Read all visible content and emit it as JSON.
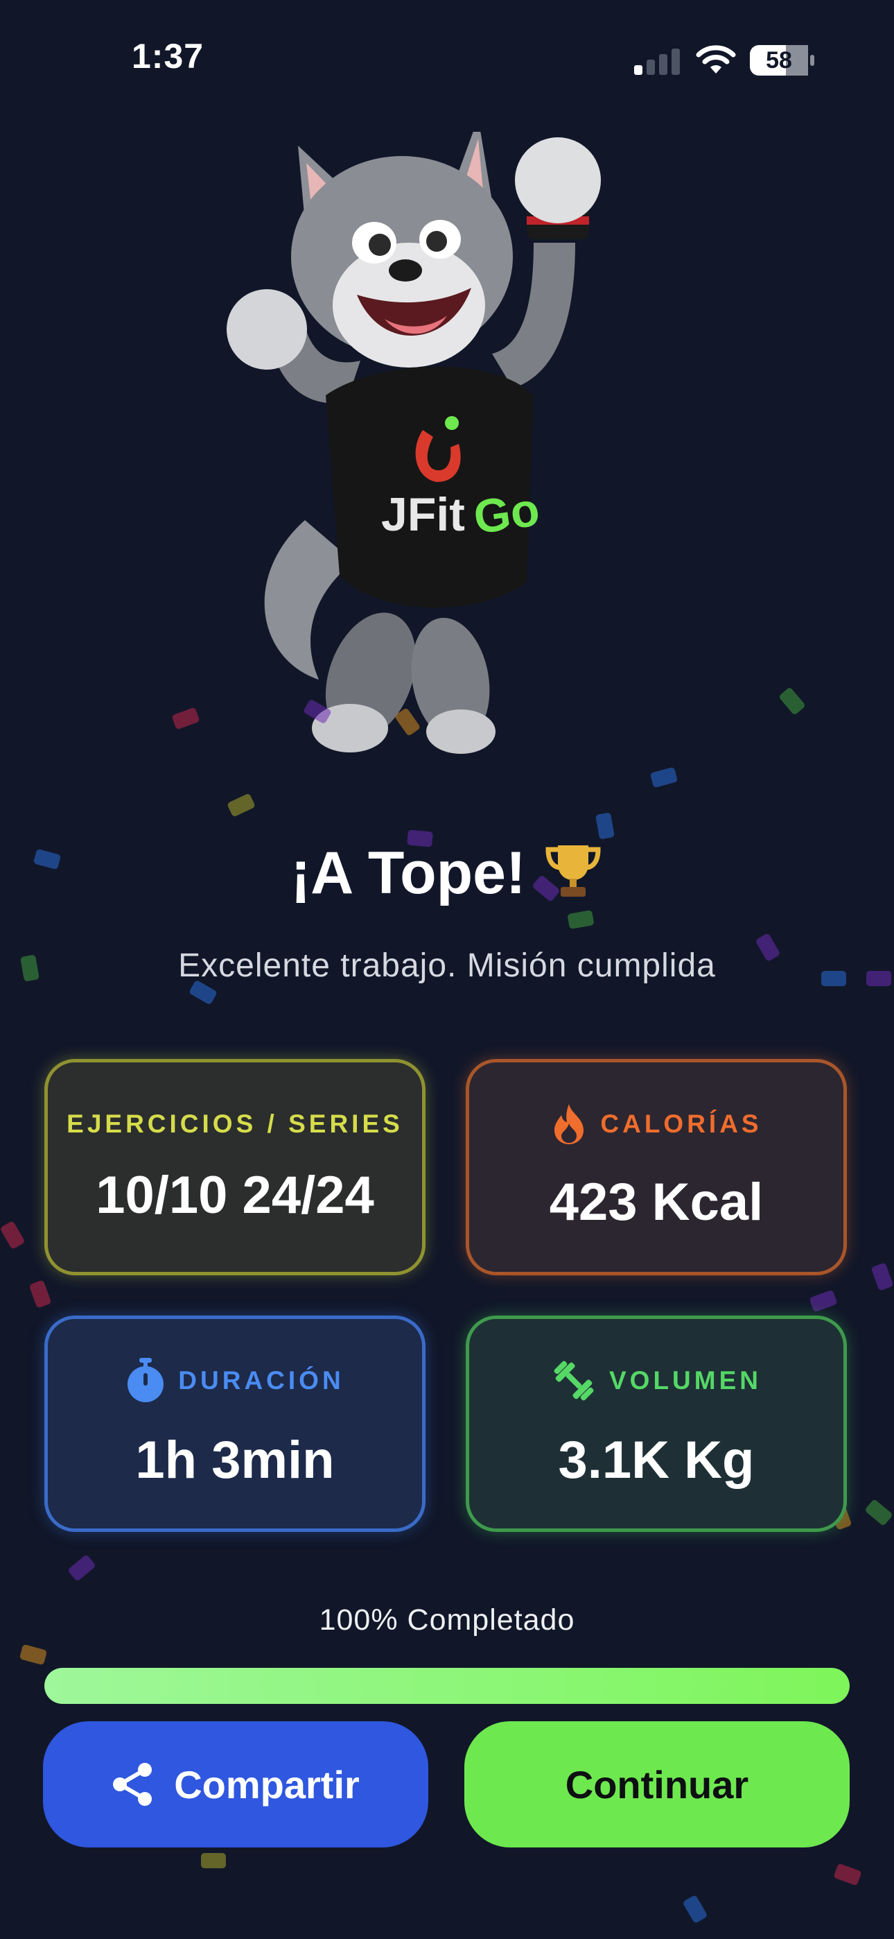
{
  "status_bar": {
    "time": "1:37",
    "battery": "58"
  },
  "mascot": {
    "shirt_brand": "JFitGo"
  },
  "headline": {
    "title": "¡A Tope!",
    "emoji": "🏆"
  },
  "subtitle": "Excelente trabajo. Misión cumplida",
  "stats": {
    "exercises": {
      "label": "EJERCICIOS / SERIES",
      "value": "10/10 24/24",
      "color": "#d6dc4a"
    },
    "calories": {
      "label": "CALORÍAS",
      "value": "423 Kcal",
      "icon": "flame-icon",
      "color": "#ef6d2d"
    },
    "duration": {
      "label": "DURACIÓN",
      "value": "1h 3min",
      "icon": "stopwatch-icon",
      "color": "#4a8cf2"
    },
    "volume": {
      "label": "VOLUMEN",
      "value": "3.1K Kg",
      "icon": "dumbbell-icon",
      "color": "#55d866"
    }
  },
  "progress": {
    "label": "100% Completado",
    "percent": 100
  },
  "buttons": {
    "share": {
      "label": "Compartir",
      "icon": "share-icon"
    },
    "continue": {
      "label": "Continuar"
    }
  }
}
